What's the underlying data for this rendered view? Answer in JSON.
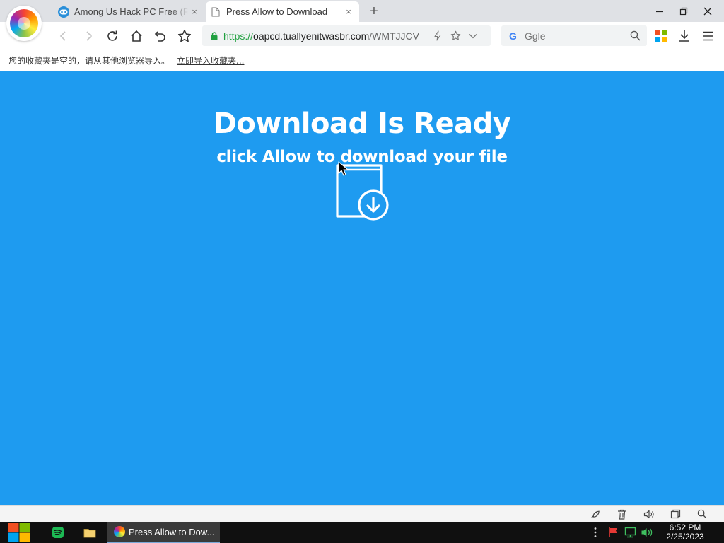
{
  "browser": {
    "tabs": [
      {
        "title": "Among Us Hack PC Free (R..."
      },
      {
        "title": "Press Allow to Download"
      }
    ],
    "tab_close": "×",
    "new_tab": "+"
  },
  "toolbar": {
    "url_scheme": "https://",
    "url_host": "oapcd.tuallyenitwasbr.com",
    "url_path": "/WMTJJCV",
    "search_engine_glyph": "G",
    "search_placeholder": "Ggle"
  },
  "bookmarks_bar": {
    "message": "您的收藏夹是空的，请从其他浏览器导入。",
    "import_link": "立即导入收藏夹..."
  },
  "page": {
    "headline": "Download Is Ready",
    "subheadline": "click Allow to download your file"
  },
  "taskbar": {
    "active_window": "Press Allow to Dow...",
    "time": "6:52 PM",
    "date": "2/25/2023"
  },
  "colors": {
    "page_background": "#1e9bf0",
    "secure_green": "#20a040"
  },
  "icons": [
    "browser-logo-icon",
    "gamepad-favicon-icon",
    "document-favicon-icon",
    "back-icon",
    "forward-icon",
    "reload-icon",
    "home-icon",
    "undo-icon",
    "star-icon",
    "lock-icon",
    "lightning-icon",
    "bookmark-star-icon",
    "chevron-down-icon",
    "google-icon",
    "search-icon",
    "apps-icon",
    "download-icon",
    "menu-icon",
    "file-download-icon",
    "windows-start-icon",
    "spotify-icon",
    "folder-icon",
    "flag-icon",
    "network-icon",
    "volume-icon"
  ]
}
